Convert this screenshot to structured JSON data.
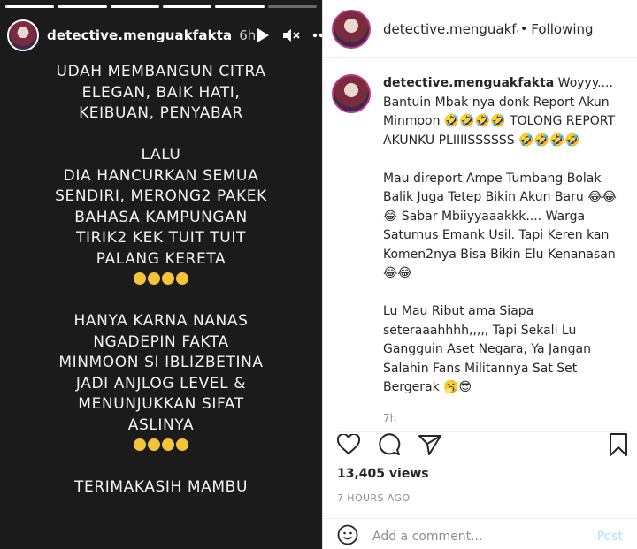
{
  "story": {
    "username": "detective.menguakfakta",
    "time": "6h",
    "lines": [
      "UDAH MEMBANGUN CITRA",
      "ELEGAN, BAIK HATI,",
      "KEIBUAN, PENYABAR",
      "",
      "LALU",
      "DIA HANCURKAN SEMUA",
      "SENDIRI, MERONG2 PAKEK",
      "BAHASA KAMPUNGAN",
      "TIRIK2 KEK TUIT TUIT",
      "PALANG KERETA",
      "[emoji4]",
      "",
      "HANYA KARNA NANAS",
      "NGADEPIN FAKTA",
      "MINMOON SI IBLIZBETINA",
      "JADI ANJLOG LEVEL &",
      "MENUNJUKKAN SIFAT",
      "ASLINYA",
      "[emoji4]",
      "",
      "TERIMAKASIH MAMBU"
    ]
  },
  "post": {
    "header_username": "detective.menguakfakt",
    "follow_label": "Following",
    "caption_username": "detective.menguakfakta",
    "caption_paragraphs": [
      "Woyyy.... Bantuin Mbak nya donk Report Akun Minmoon 🤣🤣🤣🤣 TOLONG REPORT AKUNKU PLIIIISSSSSS 🤣🤣🤣🤣",
      "Mau direport Ampe Tumbang Bolak Balik Juga Tetep Bikin Akun Baru 😂😂😂 Sabar Mbiiyyaaakkk.... Warga Saturnus Emank Usil. Tapi Keren kan Komen2nya Bisa Bikin Elu Kenanasan 😂😂",
      "Lu Mau Ribut ama Siapa seteraaahhhh,,,,, Tapi Sekali Lu Gangguin Aset Negara, Ya Jangan Salahin Fans Militannya Sat Set Bergerak 🥱😎"
    ],
    "caption_time": "7h",
    "views": "13,405 views",
    "posted": "7 HOURS AGO",
    "comment_placeholder": "Add a comment...",
    "post_label": "Post"
  },
  "colors": {
    "story_bg": "#1b1b1b",
    "post_button": "#b2dffc",
    "avatar_ring": "#c13584"
  },
  "icons": [
    "play-icon",
    "mute-icon",
    "more-icon",
    "heart-icon",
    "comment-icon",
    "share-icon",
    "bookmark-icon",
    "emoji-icon"
  ]
}
